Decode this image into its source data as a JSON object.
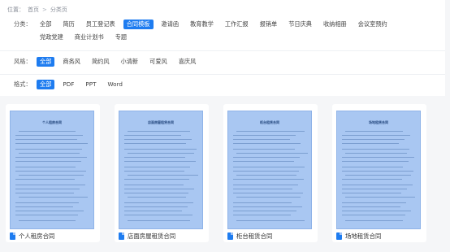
{
  "breadcrumb": {
    "prefix": "位置：",
    "home": "首页",
    "separator": ">",
    "current": "分类页"
  },
  "filters": {
    "category": {
      "label": "分类：",
      "options": [
        "全部",
        "简历",
        "员工登记表",
        "合同模板",
        "邀请函",
        "教育教学",
        "工作汇报",
        "报销单",
        "节日庆典",
        "收纳相册",
        "会议室预约",
        "党政党建",
        "商业计划书",
        "专题"
      ],
      "active_index": 3
    },
    "style": {
      "label": "风格：",
      "options": [
        "全部",
        "商务风",
        "简约风",
        "小清新",
        "可爱风",
        "喜庆风"
      ],
      "active_index": 0
    },
    "format": {
      "label": "格式：",
      "options": [
        "全部",
        "PDF",
        "PPT",
        "Word"
      ],
      "active_index": 0
    }
  },
  "cards": [
    {
      "name": "个人租房合同",
      "doc_heading": "个人租房合同"
    },
    {
      "name": "店面房屋租赁合同",
      "doc_heading": "店面房屋租赁合同"
    },
    {
      "name": "柜台租赁合同",
      "doc_heading": "柜台租赁合同"
    },
    {
      "name": "场地租赁合同",
      "doc_heading": "场地租赁合同"
    }
  ],
  "colors": {
    "accent": "#1e7cf0",
    "thumb_fill": "#a9c7f2"
  }
}
